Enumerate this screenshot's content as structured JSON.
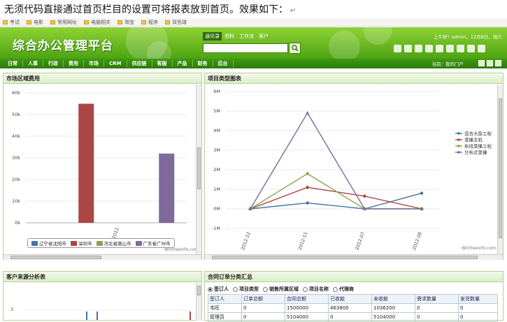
{
  "caption": "无须代码直接通过首页栏目的设置可将报表放到首页。效果如下：",
  "caption_mark": "↵",
  "bookmarks": [
    "考试",
    "电影",
    "常用网址",
    "电脑相关",
    "淘宝",
    "程序",
    "双色球"
  ],
  "app": {
    "title": "综合办公管理平台",
    "search_tabs": [
      "通讯录",
      "资料",
      "工作流",
      "客户"
    ],
    "welcome": "上午好！admin，12月8日，周六",
    "nav": [
      "日常",
      "人事",
      "行政",
      "费用",
      "市场",
      "CRM",
      "供应链",
      "客服",
      "产品",
      "财务",
      "后台"
    ],
    "current_location": "当前：我的门户"
  },
  "panels": {
    "market": {
      "title": "市场区域费用"
    },
    "project": {
      "title": "项目类型图表"
    },
    "customer": {
      "title": "客户来源分析表"
    },
    "orders": {
      "title": "合同订单分类汇总"
    }
  },
  "watermark": "Winfreeinfo.com",
  "chart_data": [
    {
      "type": "bar",
      "title": "",
      "categories": [
        "2012"
      ],
      "ylim": [
        0,
        60000
      ],
      "yticks": [
        "0k",
        "10k",
        "20k",
        "30k",
        "40k",
        "50k",
        "60k"
      ],
      "series": [
        {
          "name": "辽宁省沈阳市",
          "values": [
            0
          ],
          "color": "#4572a7"
        },
        {
          "name": "深圳市",
          "values": [
            55000
          ],
          "color": "#aa4643"
        },
        {
          "name": "河北省唐山市",
          "values": [
            0
          ],
          "color": "#89a54e"
        },
        {
          "name": "广东省广州市",
          "values": [
            32000
          ],
          "color": "#80699b"
        }
      ],
      "legend": "bottom",
      "grid": true
    },
    {
      "type": "line",
      "title": "",
      "categories": [
        "2012-12",
        "2012-11",
        "2012-07",
        "2012-06"
      ],
      "ylim": [
        -1000000,
        6000000
      ],
      "yticks": [
        "-1M",
        "0M",
        "1M",
        "2M",
        "3M",
        "4M",
        "5M",
        "6M"
      ],
      "series": [
        {
          "name": "混合大型工程",
          "values": [
            0,
            300000,
            0,
            800000
          ],
          "color": "#4572a7"
        },
        {
          "name": "录播主机",
          "values": [
            0,
            1100000,
            650000,
            0
          ],
          "color": "#aa4643"
        },
        {
          "name": "布线录播工程",
          "values": [
            0,
            1800000,
            0,
            0
          ],
          "color": "#89a54e"
        },
        {
          "name": "分布式录播",
          "values": [
            0,
            4900000,
            0,
            0
          ],
          "color": "#80699b"
        }
      ],
      "legend": "right",
      "grid": true
    }
  ],
  "customer_chart": {
    "ytick": "3"
  },
  "orders": {
    "radios": [
      {
        "label": "签订人",
        "checked": true
      },
      {
        "label": "项目类型",
        "checked": false
      },
      {
        "label": "销售所属区域",
        "checked": false
      },
      {
        "label": "项目名称",
        "checked": false
      },
      {
        "label": "代理商",
        "checked": false
      }
    ],
    "columns": [
      "签订人",
      "订单总额",
      "合同总额",
      "已收款",
      "未收款",
      "需求数量",
      "发货数量"
    ],
    "rows": [
      [
        "韦旺",
        "0",
        "1500000",
        "463800",
        "1036200",
        "0",
        "0"
      ],
      [
        "管理员",
        "0",
        "5104000",
        "0",
        "5104000",
        "0",
        "0"
      ]
    ]
  }
}
